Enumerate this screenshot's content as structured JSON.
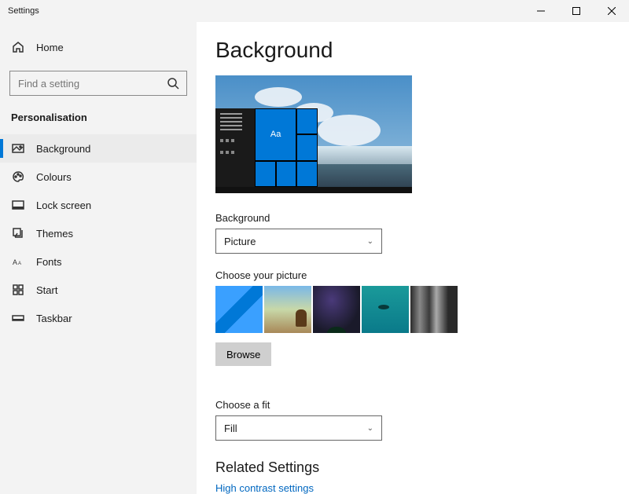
{
  "window": {
    "title": "Settings"
  },
  "sidebar": {
    "home_label": "Home",
    "search_placeholder": "Find a setting",
    "section": "Personalisation",
    "items": [
      {
        "label": "Background",
        "icon": "picture-icon",
        "active": true
      },
      {
        "label": "Colours",
        "icon": "palette-icon",
        "active": false
      },
      {
        "label": "Lock screen",
        "icon": "lock-screen-icon",
        "active": false
      },
      {
        "label": "Themes",
        "icon": "themes-icon",
        "active": false
      },
      {
        "label": "Fonts",
        "icon": "fonts-icon",
        "active": false
      },
      {
        "label": "Start",
        "icon": "start-icon",
        "active": false
      },
      {
        "label": "Taskbar",
        "icon": "taskbar-icon",
        "active": false
      }
    ]
  },
  "main": {
    "heading": "Background",
    "preview_tile_text": "Aa",
    "background_label": "Background",
    "background_value": "Picture",
    "choose_picture_label": "Choose your picture",
    "browse_label": "Browse",
    "choose_fit_label": "Choose a fit",
    "fit_value": "Fill",
    "related_heading": "Related Settings",
    "related_link": "High contrast settings"
  }
}
